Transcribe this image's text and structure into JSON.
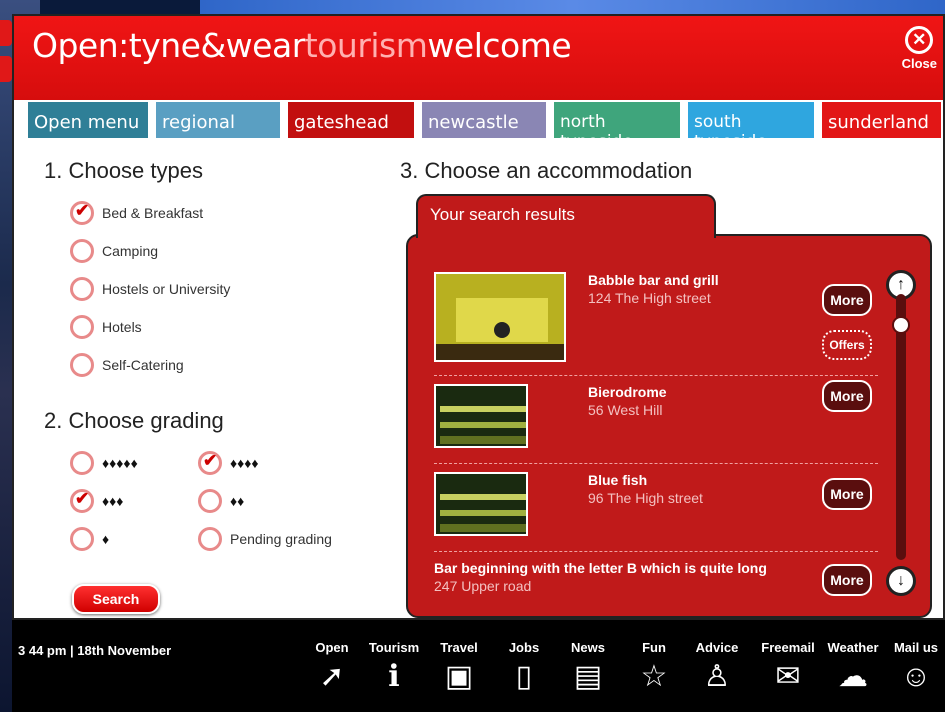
{
  "logo": {
    "open": "Open:",
    "tyne": "tyne&wear",
    "tourism": "tourism",
    "welcome": "welcome"
  },
  "close": {
    "label": "Close"
  },
  "tabs": [
    {
      "label": "Open menu",
      "color": "#2f7f97"
    },
    {
      "label": "regional",
      "color": "#5a9fc2"
    },
    {
      "label": "gateshead",
      "color": "#c20f0f"
    },
    {
      "label": "newcastle",
      "color": "#8a86b4"
    },
    {
      "label": "north tyneside",
      "color": "#3fa57c"
    },
    {
      "label": "south tyneside",
      "color": "#2fa6df"
    },
    {
      "label": "sunderland",
      "color": "#e21616"
    }
  ],
  "types": {
    "title": "1. Choose types",
    "options": [
      {
        "label": "Bed & Breakfast",
        "checked": true
      },
      {
        "label": "Camping",
        "checked": false
      },
      {
        "label": "Hostels or University",
        "checked": false
      },
      {
        "label": "Hotels",
        "checked": false
      },
      {
        "label": "Self-Catering",
        "checked": false
      }
    ]
  },
  "grading": {
    "title": "2. Choose grading",
    "options": [
      {
        "label": "♦♦♦♦♦",
        "checked": false
      },
      {
        "label": "♦♦♦♦",
        "checked": true
      },
      {
        "label": "♦♦♦",
        "checked": true
      },
      {
        "label": "♦♦",
        "checked": false
      },
      {
        "label": "♦",
        "checked": false
      },
      {
        "label": "Pending grading",
        "checked": false
      }
    ]
  },
  "search": {
    "label": "Search"
  },
  "accommodation": {
    "title": "3. Choose an accommodation",
    "results_label": "Your search results",
    "more_label": "More",
    "offers_label": "Offers",
    "items": [
      {
        "name": "Babble bar and grill",
        "address": "124 The High street"
      },
      {
        "name": "Bierodrome",
        "address": "56 West Hill"
      },
      {
        "name": "Blue fish",
        "address": "96 The High street"
      },
      {
        "name": "Bar beginning with the letter B which is quite long",
        "address": "247 Upper road"
      }
    ]
  },
  "footer": {
    "datetime": "3 44 pm | 18th November",
    "nav": [
      {
        "label": "Open",
        "icon": "open-icon"
      },
      {
        "label": "Tourism",
        "icon": "info-icon"
      },
      {
        "label": "Travel",
        "icon": "bus-icon"
      },
      {
        "label": "Jobs",
        "icon": "door-icon"
      },
      {
        "label": "News",
        "icon": "newspaper-icon"
      },
      {
        "label": "Fun",
        "icon": "stars-icon"
      },
      {
        "label": "Advice",
        "icon": "people-icon"
      },
      {
        "label": "Freemail",
        "icon": "envelope-icon"
      },
      {
        "label": "Weather",
        "icon": "weather-icon"
      },
      {
        "label": "Mail us",
        "icon": "mail-us-icon"
      }
    ]
  }
}
